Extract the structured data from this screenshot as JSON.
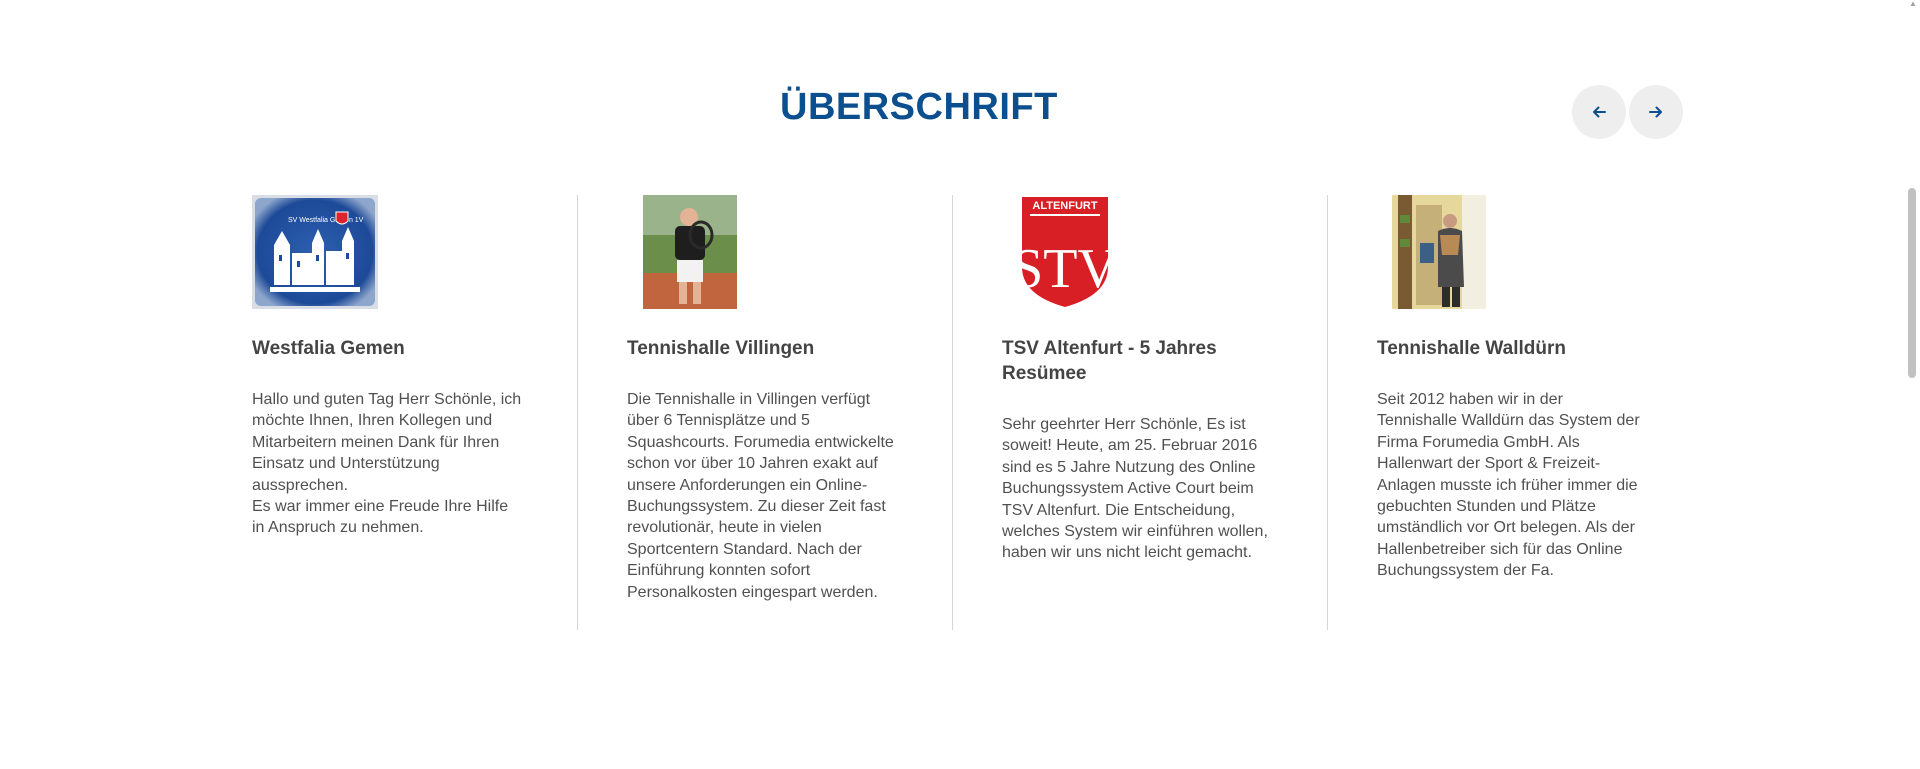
{
  "section": {
    "title": "ÜBERSCHRIFT",
    "title_color": "#0c4f8f",
    "prev_icon": "arrow-left-icon",
    "next_icon": "arrow-right-icon"
  },
  "cards": [
    {
      "title": "Westfalia Gemen",
      "logo_text": "SV Westfalia Gemen 1V",
      "text": "Hallo und guten Tag Herr Schönle, ich möchte Ihnen, Ihren Kollegen und Mitarbeitern meinen Dank für Ihren Einsatz und Unterstützung aussprechen.\nEs war immer eine Freude Ihre Hilfe in Anspruch zu nehmen."
    },
    {
      "title": "Tennishalle Villingen",
      "text": "Die Tennishalle in Villingen verfügt über 6 Tennisplätze und 5 Squashcourts. Forumedia entwickelte schon vor über 10 Jahren exakt auf unsere Anforderungen ein Online-Buchungssystem. Zu dieser Zeit fast revolutionär, heute in vielen Sportcentern Standard. Nach der Einführung konnten sofort Personalkosten eingespart werden."
    },
    {
      "title": "TSV Altenfurt - 5 Jahres Resümee",
      "logo_text": "ALTENFURT",
      "logo_letters": "STV",
      "text": "Sehr geehrter Herr Schönle, Es ist soweit! Heute, am 25. Februar 2016 sind es 5 Jahre Nutzung des Online Buchungssystem Active Court beim TSV Altenfurt. Die Entscheidung, welches System wir einführen wollen, haben wir uns nicht leicht gemacht."
    },
    {
      "title": "Tennishalle Walldürn",
      "text": "Seit 2012 haben wir in der Tennishalle Walldürn das System der Firma Forumedia GmbH. Als Hallenwart der Sport & Freizeit-Anlagen musste ich früher immer die gebuchten Stunden und Plätze umständlich vor Ort belegen. Als der Hallenbetreiber sich für das Online Buchungssystem der Fa."
    }
  ]
}
